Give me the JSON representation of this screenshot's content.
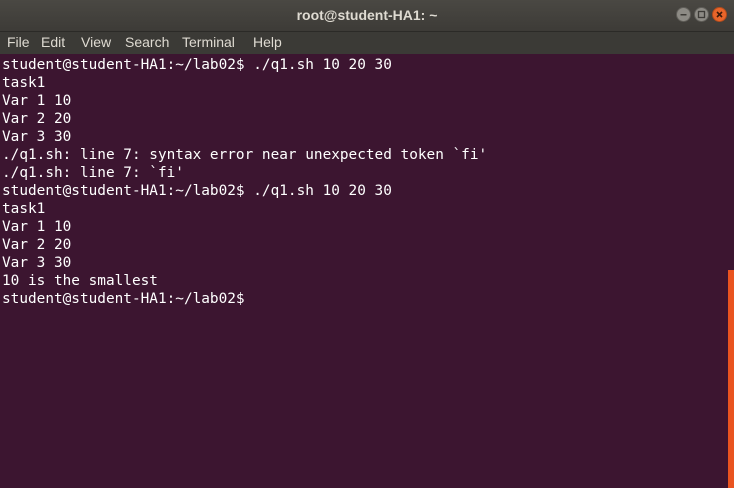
{
  "window": {
    "title": "root@student-HA1: ~"
  },
  "menu": {
    "items": [
      "File",
      "Edit",
      "View",
      "Search",
      "Terminal",
      "Help"
    ]
  },
  "terminal": {
    "lines": [
      "student@student-HA1:~/lab02$ ./q1.sh 10 20 30",
      "task1",
      "Var 1 10",
      "Var 2 20",
      "Var 3 30",
      "./q1.sh: line 7: syntax error near unexpected token `fi'",
      "./q1.sh: line 7: `fi'",
      "student@student-HA1:~/lab02$ ./q1.sh 10 20 30",
      "task1",
      "Var 1 10",
      "Var 2 20",
      "Var 3 30",
      "10 is the smallest",
      "student@student-HA1:~/lab02$"
    ]
  },
  "colors": {
    "background": "#3c1530",
    "text": "#ffffff",
    "accent": "#e95420"
  }
}
